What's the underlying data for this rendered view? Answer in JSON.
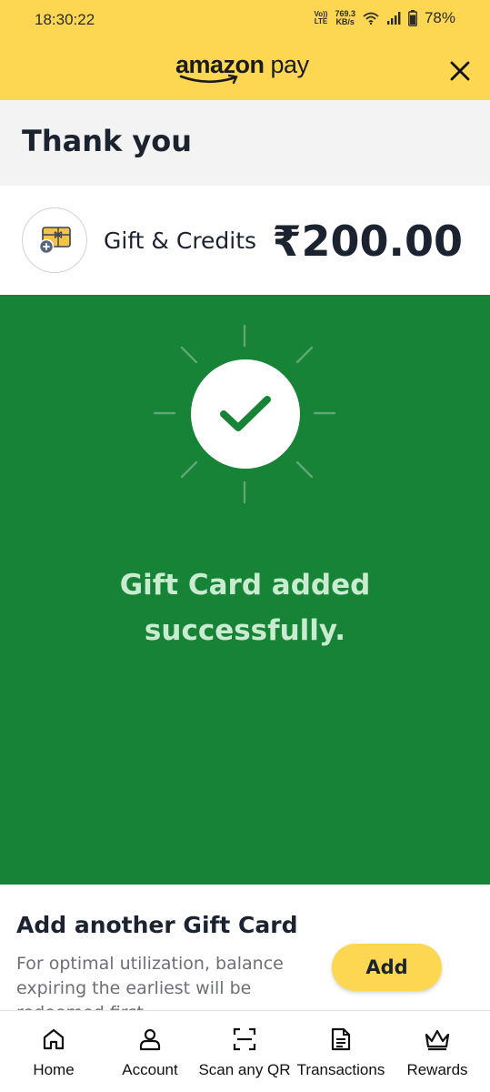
{
  "status_bar": {
    "time": "18:30:22",
    "volte_top": "Vo))",
    "volte_bottom": "LTE",
    "speed_value": "769.3",
    "speed_unit": "KB/s",
    "battery": "78%"
  },
  "app_bar": {
    "logo_brand": "amazon",
    "logo_product": " pay",
    "close_icon": "close-icon"
  },
  "thank_you": {
    "title": "Thank you"
  },
  "payment": {
    "icon": "gift-card-icon",
    "label": "Gift & Credits",
    "amount": "₹200.00"
  },
  "success": {
    "icon": "checkmark-icon",
    "line1": "Gift Card added",
    "line2": "successfully."
  },
  "add_another": {
    "title": "Add another Gift Card",
    "description": "For optimal utilization, balance expiring the earliest will be redeemed first.",
    "button_label": "Add"
  },
  "bottom_nav": {
    "items": [
      {
        "label": "Home",
        "icon": "home-icon"
      },
      {
        "label": "Account",
        "icon": "account-icon"
      },
      {
        "label": "Scan any QR",
        "icon": "scan-qr-icon"
      },
      {
        "label": "Transactions",
        "icon": "transactions-icon"
      },
      {
        "label": "Rewards",
        "icon": "rewards-crown-icon"
      }
    ]
  },
  "colors": {
    "header_yellow": "#fdd652",
    "success_green": "#168336",
    "success_text": "#c9ecd0",
    "text_dark": "#1b2331"
  }
}
